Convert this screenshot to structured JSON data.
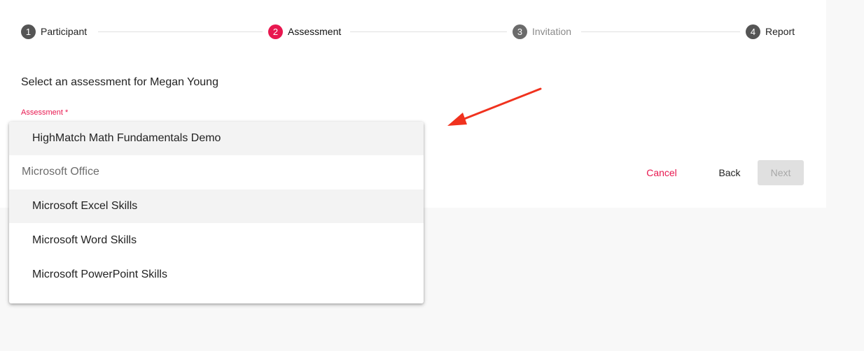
{
  "stepper": {
    "steps": [
      {
        "number": "1",
        "label": "Participant",
        "state": "done",
        "color": "#555555"
      },
      {
        "number": "2",
        "label": "Assessment",
        "state": "active",
        "color": "#e8174f"
      },
      {
        "number": "3",
        "label": "Invitation",
        "state": "upcoming",
        "color": "#6b6b6b"
      },
      {
        "number": "4",
        "label": "Report",
        "state": "upcoming",
        "color": "#555555"
      }
    ]
  },
  "form": {
    "prompt": "Select an assessment for Megan Young",
    "assessment_label": "Assessment *"
  },
  "dropdown": {
    "items": [
      {
        "type": "option",
        "label": "HighMatch Math Fundamentals Demo",
        "highlighted": true
      },
      {
        "type": "group",
        "label": "Microsoft Office",
        "highlighted": false
      },
      {
        "type": "option",
        "label": "Microsoft Excel Skills",
        "highlighted": true
      },
      {
        "type": "option",
        "label": "Microsoft Word Skills",
        "highlighted": false
      },
      {
        "type": "option",
        "label": "Microsoft PowerPoint Skills",
        "highlighted": false
      }
    ]
  },
  "actions": {
    "cancel": "Cancel",
    "back": "Back",
    "next": "Next"
  },
  "colors": {
    "accent": "#e8174f",
    "annotation_arrow": "#f0321e"
  }
}
